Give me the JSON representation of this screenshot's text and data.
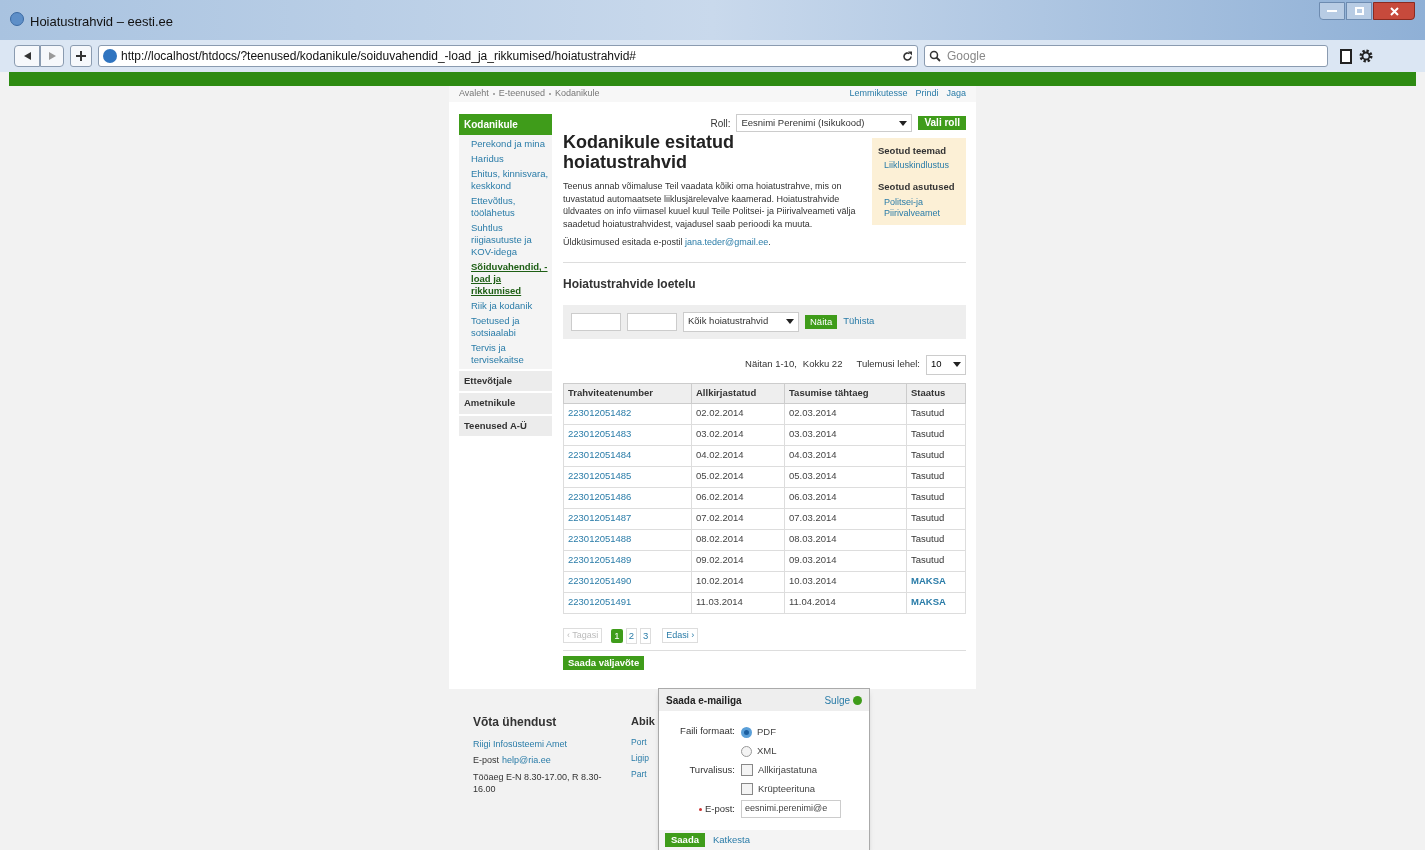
{
  "browser": {
    "tab_title": "Hoiatustrahvid – eesti.ee",
    "url": "http://localhost/htdocs/?teenused/kodanikule/soiduvahendid_-load_ja_rikkumised/hoiatustrahvid#",
    "search_placeholder": "Google"
  },
  "breadcrumb": [
    "Avaleht",
    "E-teenused",
    "Kodanikule"
  ],
  "page_actions": [
    "Lemmikutesse",
    "Prindi",
    "Jaga"
  ],
  "sidebar": {
    "header": "Kodanikule",
    "items": [
      {
        "label": "Perekond ja mina",
        "selected": false
      },
      {
        "label": "Haridus",
        "selected": false
      },
      {
        "label": "Ehitus, kinnisvara, keskkond",
        "selected": false
      },
      {
        "label": "Ettevõtlus, töölähetus",
        "selected": false
      },
      {
        "label": "Suhtlus riigiasutuste ja KOV-idega",
        "selected": false
      },
      {
        "label": "Sõiduvahendid, -load ja rikkumised",
        "selected": true
      },
      {
        "label": "Riik ja kodanik",
        "selected": false
      },
      {
        "label": "Toetused ja sotsiaalabi",
        "selected": false
      },
      {
        "label": "Tervis ja tervisekaitse",
        "selected": false
      }
    ],
    "sections": [
      "Ettevõtjale",
      "Ametnikule",
      "Teenused A-Ü"
    ]
  },
  "role": {
    "label": "Roll:",
    "value": "Eesnimi Perenimi (Isikukood)",
    "button": "Vali roll"
  },
  "title": "Kodanikule esitatud hoiatustrahvid",
  "intro": "Teenus annab võimaluse Teil vaadata kõiki oma hoiatustrahve, mis on tuvastatud automaatsete liiklusjärelevalve kaamerad. Hoiatustrahvide üldvaates on info viimasel kuuel kuul Teile Politsei- ja Piirivalveameti välja saadetud hoiatustrahvidest, vajadusel saab perioodi ka muuta.",
  "contact": {
    "text": "Üldküsimused esitada e-postil",
    "link": "jana.teder@gmail.ee",
    "end": "."
  },
  "related": [
    {
      "heading": "Seotud teemad",
      "links": [
        "Liikluskindlustus"
      ]
    },
    {
      "heading": "Seotud asutused",
      "links": [
        "Politsei-ja Piirivalveamet"
      ]
    }
  ],
  "list_title": "Hoiatustrahvide loetelu",
  "filter": {
    "type_value": "Kõik hoiatustrahvid",
    "show_button": "Näita",
    "clear_link": "Tühista"
  },
  "results": {
    "summary": "Näitan 1-10,",
    "total": "Kokku 22",
    "per_page_label": "Tulemusi lehel:",
    "per_page_value": "10"
  },
  "table": {
    "columns": [
      "Trahviteatenumber",
      "Allkirjastatud",
      "Tasumise tähtaeg",
      "Staatus"
    ],
    "rows": [
      {
        "number": "223012051482",
        "signed": "02.02.2014",
        "due": "02.03.2014",
        "status": "Tasutud",
        "kind": "paid"
      },
      {
        "number": "223012051483",
        "signed": "03.02.2014",
        "due": "03.03.2014",
        "status": "Tasutud",
        "kind": "paid"
      },
      {
        "number": "223012051484",
        "signed": "04.02.2014",
        "due": "04.03.2014",
        "status": "Tasutud",
        "kind": "paid"
      },
      {
        "number": "223012051485",
        "signed": "05.02.2014",
        "due": "05.03.2014",
        "status": "Tasutud",
        "kind": "paid"
      },
      {
        "number": "223012051486",
        "signed": "06.02.2014",
        "due": "06.03.2014",
        "status": "Tasutud",
        "kind": "paid"
      },
      {
        "number": "223012051487",
        "signed": "07.02.2014",
        "due": "07.03.2014",
        "status": "Tasutud",
        "kind": "paid"
      },
      {
        "number": "223012051488",
        "signed": "08.02.2014",
        "due": "08.03.2014",
        "status": "Tasutud",
        "kind": "paid"
      },
      {
        "number": "223012051489",
        "signed": "09.02.2014",
        "due": "09.03.2014",
        "status": "Tasutud",
        "kind": "paid"
      },
      {
        "number": "223012051490",
        "signed": "10.02.2014",
        "due": "10.03.2014",
        "status": "MAKSA",
        "kind": "pay"
      },
      {
        "number": "223012051491",
        "signed": "11.03.2014",
        "due": "11.04.2014",
        "status": "MAKSA",
        "kind": "pay"
      }
    ]
  },
  "pagination": {
    "prev": "‹ Tagasi",
    "pages": [
      {
        "label": "1",
        "selected": true
      },
      {
        "label": "2",
        "selected": false
      },
      {
        "label": "3",
        "selected": false
      }
    ],
    "next": "Edasi ›"
  },
  "send_button": "Saada väljavõte",
  "email_dialog": {
    "title": "Saada e-mailiga",
    "close": "Sulge",
    "format_label": "Faili formaat:",
    "formats": [
      {
        "label": "PDF",
        "selected": true
      },
      {
        "label": "XML",
        "selected": false
      }
    ],
    "security_label": "Turvalisus:",
    "security": [
      {
        "label": "Allkirjastatuna",
        "checked": false
      },
      {
        "label": "Krüpteerituna",
        "checked": false
      }
    ],
    "email_label": "E-post:",
    "email_value": "eesnimi.perenimi@e",
    "submit": "Saada",
    "cancel": "Katkesta"
  },
  "footer": {
    "contact_heading": "Võta ühendust",
    "org": "Riigi Infosüsteemi Amet",
    "email_label": "E-post",
    "email": "help@ria.ee",
    "hours": "Tööaeg E-N 8.30-17.00, R 8.30-16.00",
    "help_heading": "Abik",
    "help_links": [
      "Port",
      "Ligip",
      "Part"
    ]
  }
}
